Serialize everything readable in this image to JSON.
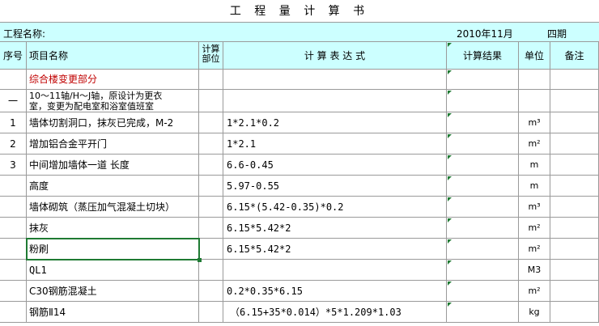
{
  "title": "工 程 量 计 算 书",
  "info": {
    "project_label": "工程名称:",
    "date": "2010年11月",
    "period": "四期"
  },
  "headers": {
    "seq": "序号",
    "name": "项目名称",
    "part_line1": "计算",
    "part_line2": "部位",
    "expr": "计 算 表 达 式",
    "result": "计算结果",
    "unit": "单位",
    "note": "备注"
  },
  "rows": [
    {
      "seq": "",
      "name": "综合楼变更部分",
      "expr": "",
      "unit": ""
    },
    {
      "seq": "一",
      "name_line1": "10～11轴/H～J轴，原设计为更衣",
      "name_line2": "室，变更为配电室和浴室值班室",
      "expr": "",
      "unit": ""
    },
    {
      "seq": "1",
      "name": "墙体切割洞口，抹灰已完成，M-2",
      "expr": "1*2.1*0.2",
      "unit": "m³"
    },
    {
      "seq": "2",
      "name": "增加铝合金平开门",
      "expr": "1*2.1",
      "unit": "m²"
    },
    {
      "seq": "3",
      "name": "中间增加墙体一道 长度",
      "expr": "6.6-0.45",
      "unit": "m"
    },
    {
      "seq": "",
      "name": "高度",
      "expr": "5.97-0.55",
      "unit": "m"
    },
    {
      "seq": "",
      "name": "墙体砌筑（蒸压加气混凝土切块）",
      "expr": "6.15*(5.42-0.35)*0.2",
      "unit": "m³"
    },
    {
      "seq": "",
      "name": "抹灰",
      "expr": "6.15*5.42*2",
      "unit": "m²"
    },
    {
      "seq": "",
      "name": "粉刷",
      "expr": "6.15*5.42*2",
      "unit": "m²"
    },
    {
      "seq": "",
      "name": "QL1",
      "expr": "",
      "unit": "M3"
    },
    {
      "seq": "",
      "name": "C30钢筋混凝土",
      "expr": "0.2*0.35*6.15",
      "unit": "m²"
    },
    {
      "seq": "",
      "name": "钢筋Ⅱ14",
      "expr": "（6.15+35*0.014）*5*1.209*1.03",
      "unit": "kg"
    }
  ]
}
